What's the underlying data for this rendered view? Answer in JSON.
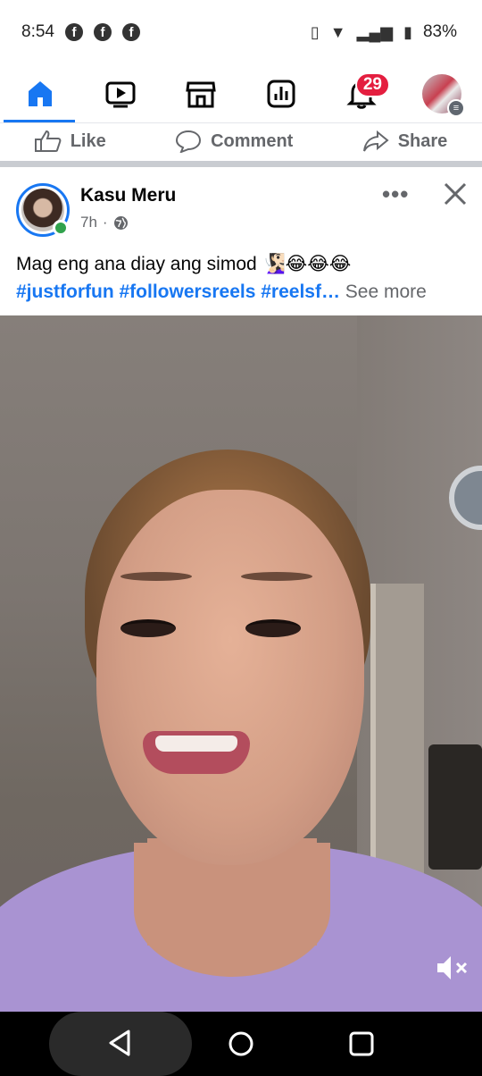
{
  "status_bar": {
    "time": "8:54",
    "notification_icons": [
      "f",
      "f",
      "f"
    ],
    "battery": "83%"
  },
  "nav": {
    "items": [
      {
        "name": "home",
        "active": true
      },
      {
        "name": "video"
      },
      {
        "name": "marketplace"
      },
      {
        "name": "dashboard"
      },
      {
        "name": "notifications",
        "badge": "29"
      },
      {
        "name": "profile-menu"
      }
    ],
    "accent": "#1877f2",
    "badge_color": "#e41e3f"
  },
  "previous_post_actions": {
    "like": "Like",
    "comment": "Comment",
    "share": "Share"
  },
  "post": {
    "author": "Kasu Meru",
    "time": "7h",
    "separator": "·",
    "caption": "Mag eng ana diay ang simod 🧏🏻‍♀️😂😂😂",
    "hashtags": "#justforfun #followersreels #reelsf…",
    "see_more": "See more"
  }
}
